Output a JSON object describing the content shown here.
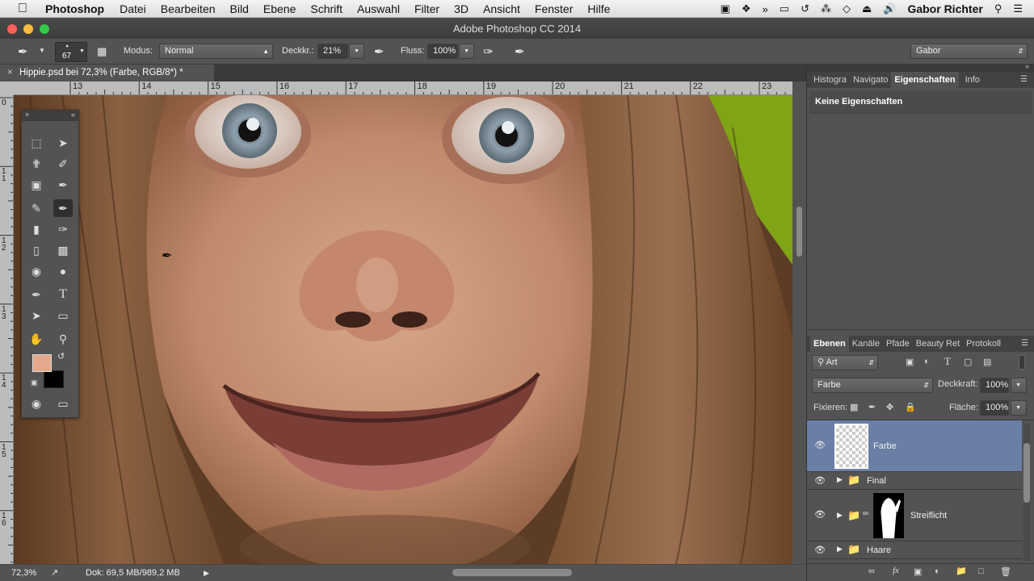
{
  "menubar": {
    "apple": "",
    "app": "Photoshop",
    "items": [
      "Datei",
      "Bearbeiten",
      "Bild",
      "Ebene",
      "Schrift",
      "Auswahl",
      "Filter",
      "3D",
      "Ansicht",
      "Fenster",
      "Hilfe"
    ],
    "user": "Gabor Richter"
  },
  "window": {
    "title": "Adobe Photoshop CC 2014"
  },
  "options": {
    "brush_size": "67",
    "modus_label": "Modus:",
    "modus_value": "Normal",
    "deckkr_label": "Deckkr.:",
    "deckkr_value": "21%",
    "fluss_label": "Fluss:",
    "fluss_value": "100%",
    "workspace": "Gabor"
  },
  "document": {
    "tab": "Hippie.psd bei 72,3% (Farbe, RGB/8*) *",
    "ruler_top": [
      "13",
      "14",
      "15",
      "16",
      "17",
      "18",
      "19",
      "20",
      "21",
      "22",
      "23"
    ],
    "ruler_left": [
      "0",
      "1\n1",
      "1\n2",
      "1\n3",
      "1\n4",
      "1\n5",
      "1\n6"
    ]
  },
  "status": {
    "zoom": "72,3%",
    "doc": "Dok: 69,5 MB/989,2 MB"
  },
  "colors": {
    "foreground": "#e2a98c",
    "background": "#000000",
    "panel": "#535353",
    "selected_layer": "#6b7fa6"
  },
  "properties_panel": {
    "tabs": [
      "Histogra",
      "Navigato",
      "Eigenschaften",
      "Info"
    ],
    "active_tab": "Eigenschaften",
    "content": "Keine Eigenschaften"
  },
  "layers_panel": {
    "tabs": [
      "Ebenen",
      "Kanäle",
      "Pfade",
      "Beauty Ret",
      "Protokoll"
    ],
    "active_tab": "Ebenen",
    "filter": "Art",
    "blend_mode": "Farbe",
    "opacity_label": "Deckkraft:",
    "opacity": "100%",
    "lock_label": "Fixieren:",
    "fill_label": "Fläche:",
    "fill": "100%",
    "layers": [
      {
        "name": "Farbe",
        "selected": true
      },
      {
        "name": "Final"
      },
      {
        "name": "Streiflicht"
      },
      {
        "name": "Haare"
      }
    ]
  }
}
